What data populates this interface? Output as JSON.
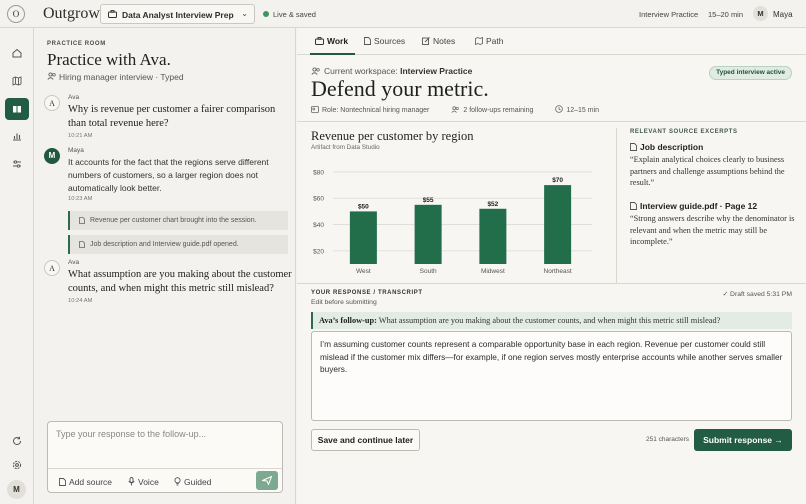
{
  "app": {
    "logo_letter": "O",
    "brand": "Outgrow",
    "workspace_select": "Data Analyst Interview Prep",
    "status": "Live & saved",
    "mode": "Interview Practice",
    "duration": "15–20 min",
    "user_initial": "M",
    "user_name": "Maya"
  },
  "chat": {
    "room_label": "PRACTICE ROOM",
    "title": "Practice with Ava.",
    "subtitle": "Hiring manager interview · Typed",
    "messages": [
      {
        "initial": "A",
        "name": "Ava",
        "text": "Why is revenue per customer a fairer comparison than total revenue here?",
        "time": "10:21 AM"
      },
      {
        "initial": "M",
        "name": "Maya",
        "text": "It accounts for the fact that the regions serve different numbers of customers, so a larger region does not automatically look better.",
        "time": "10:23 AM"
      },
      {
        "initial": "A",
        "name": "Ava",
        "text": "What assumption are you making about the customer counts, and when might this metric still mislead?",
        "time": "10:24 AM"
      }
    ],
    "events": [
      "Revenue per customer chart brought into the session.",
      "Job description and Interview guide.pdf opened."
    ],
    "composer_placeholder": "Type your response to the follow-up...",
    "tools": {
      "add_source": "Add source",
      "voice": "Voice",
      "guided": "Guided"
    }
  },
  "tabs": [
    "Work",
    "Sources",
    "Notes",
    "Path"
  ],
  "work": {
    "workspace_prefix": "Current workspace:",
    "workspace_name": "Interview Practice",
    "badge": "Typed interview active",
    "title": "Defend your metric.",
    "role": "Role: Nontechnical hiring manager",
    "followups": "2 follow-ups remaining",
    "time": "12–15 min"
  },
  "chart_data": {
    "type": "bar",
    "title": "Revenue per customer by region",
    "subtitle": "Artifact from Data Studio",
    "categories": [
      "West",
      "South",
      "Midwest",
      "Northeast"
    ],
    "values": [
      50,
      55,
      52,
      70
    ],
    "value_labels": [
      "$50",
      "$55",
      "$52",
      "$70"
    ],
    "y_ticks": [
      "$20",
      "$40",
      "$60",
      "$80"
    ],
    "y_tick_values": [
      20,
      40,
      60,
      80
    ],
    "ylim": [
      10,
      83
    ],
    "bar_color": "#226e4b",
    "grid": true
  },
  "excerpts": {
    "label": "RELEVANT SOURCE EXCERPTS",
    "items": [
      {
        "title": "Job description",
        "text": "“Explain analytical choices clearly to business partners and challenge assumptions behind the result.”"
      },
      {
        "title": "Interview guide.pdf · Page 12",
        "text": "“Strong answers describe why the denominator is relevant and when the metric may still be incomplete.”"
      }
    ]
  },
  "response": {
    "label": "YOUR RESPONSE / TRANSCRIPT",
    "sub": "Edit before submitting",
    "draft_saved": "Draft saved 5:31 PM",
    "followup_prefix": "Ava’s follow-up:",
    "followup_text": "What assumption are you making about the customer counts, and when might this metric still mislead?",
    "answer": "I’m assuming customer counts represent a comparable opportunity base in each region. Revenue per customer could still mislead if the customer mix differs—for example, if one region serves mostly enterprise accounts while another serves smaller buyers.",
    "save_label": "Save and continue later",
    "char_count": "251 characters",
    "submit_label": "Submit response"
  },
  "colors": {
    "accent": "#225c45",
    "live": "#3f9560",
    "bar": "#226e4b"
  }
}
